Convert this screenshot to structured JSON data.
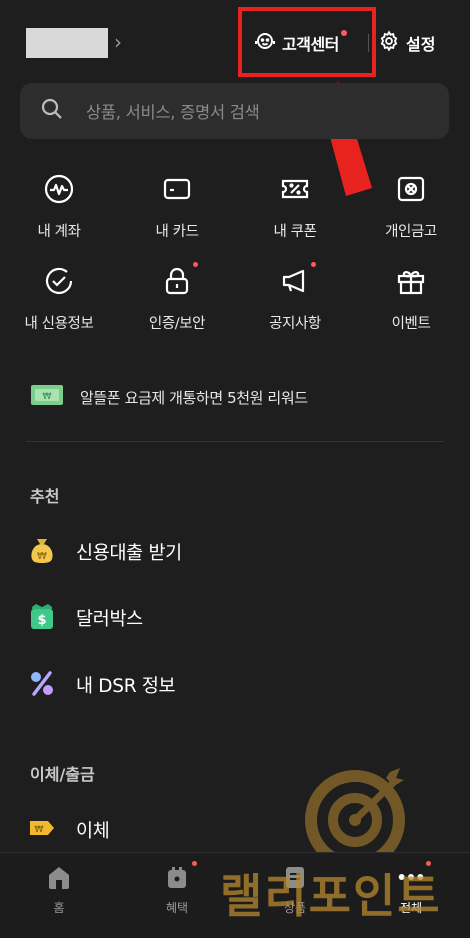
{
  "header": {
    "chevron": "›",
    "customer_center_label": "고객센터",
    "settings_label": "설정"
  },
  "search": {
    "placeholder": "상품, 서비스, 증명서 검색"
  },
  "quick_menu": [
    {
      "label": "내 계좌",
      "icon": "account-wave-icon",
      "badge": false
    },
    {
      "label": "내 카드",
      "icon": "card-icon",
      "badge": false
    },
    {
      "label": "내 쿠폰",
      "icon": "coupon-icon",
      "badge": false
    },
    {
      "label": "개인금고",
      "icon": "safe-icon",
      "badge": false
    },
    {
      "label": "내 신용정보",
      "icon": "credit-check-icon",
      "badge": false
    },
    {
      "label": "인증/보안",
      "icon": "lock-icon",
      "badge": true
    },
    {
      "label": "공지사항",
      "icon": "megaphone-icon",
      "badge": true
    },
    {
      "label": "이벤트",
      "icon": "gift-icon",
      "badge": false
    }
  ],
  "promo": {
    "label": "알뜰폰 요금제 개통하면 5천원 리워드",
    "icon": "cash-bill-icon"
  },
  "sections": {
    "recommend_title": "추천",
    "recommend_items": [
      {
        "label": "신용대출 받기",
        "icon": "money-bag-icon"
      },
      {
        "label": "달러박스",
        "icon": "dollar-box-icon"
      },
      {
        "label": "내 DSR 정보",
        "icon": "percent-icon"
      }
    ],
    "transfer_title": "이체/출금",
    "transfer_items": [
      {
        "label": "이체",
        "icon": "transfer-tag-icon"
      }
    ]
  },
  "bottom_nav": [
    {
      "label": "홈",
      "icon": "home-icon",
      "badge": false,
      "active": false
    },
    {
      "label": "혜택",
      "icon": "benefit-icon",
      "badge": true,
      "active": false
    },
    {
      "label": "상품",
      "icon": "product-icon",
      "badge": false,
      "active": false
    },
    {
      "label": "전체",
      "icon": "more-dots-icon",
      "badge": true,
      "active": true
    }
  ],
  "watermark_text": "랠리포인트",
  "colors": {
    "background": "#1e1e1e",
    "highlight": "#e8231f",
    "badge": "#ff5a5a",
    "watermark": "#b8892f"
  }
}
